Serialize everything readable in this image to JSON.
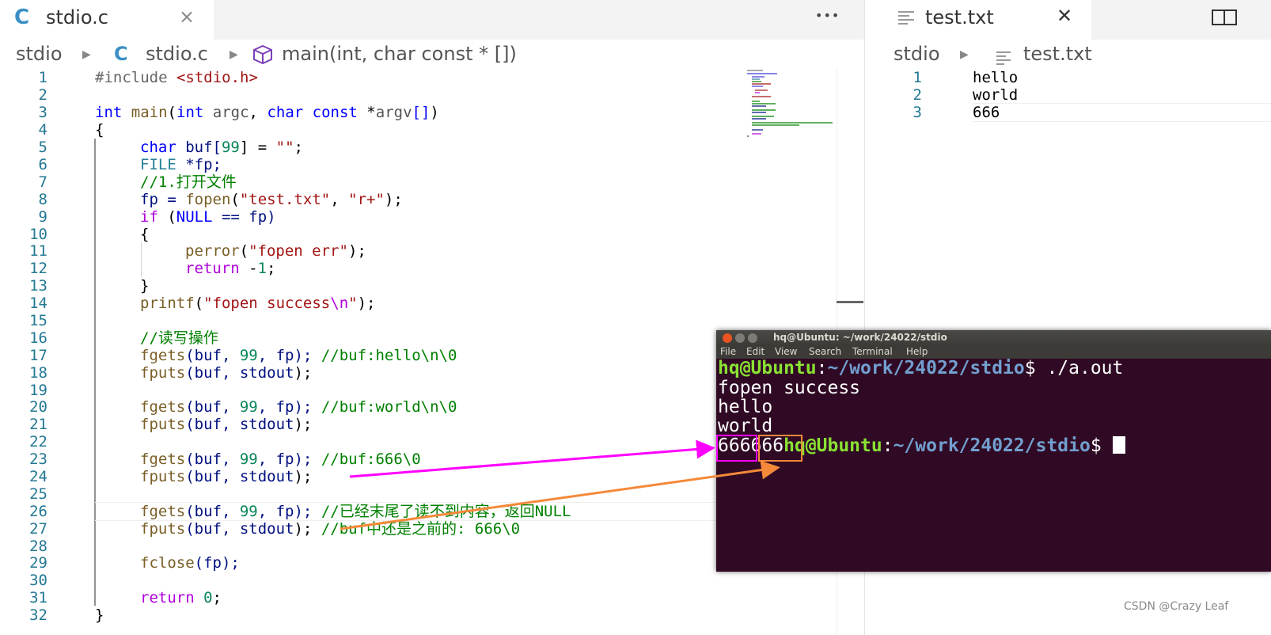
{
  "left": {
    "tab_label": "stdio.c",
    "tab_icon": "C",
    "close_glyph": "×",
    "more_glyph": "•••",
    "breadcrumb": {
      "folder": "stdio",
      "file_icon": "C",
      "file": "stdio.c",
      "symbol": "main(int, char const * [])"
    },
    "line_numbers": [
      "1",
      "2",
      "3",
      "4",
      "5",
      "6",
      "7",
      "8",
      "9",
      "10",
      "11",
      "12",
      "13",
      "14",
      "15",
      "16",
      "17",
      "18",
      "19",
      "20",
      "21",
      "22",
      "23",
      "24",
      "25",
      "26",
      "27",
      "28",
      "29",
      "30",
      "31",
      "32"
    ],
    "code": {
      "l1": {
        "a": "#include ",
        "b": "<stdio.h>"
      },
      "l3": {
        "a": "int",
        "b": " ",
        "c": "main",
        "d": "(",
        "e": "int",
        "f": " ",
        "g": "argc",
        ",": ", ",
        "h": "char",
        "i": " ",
        "j": "const",
        "k": " *",
        "l": "argv",
        "m": "[]",
        "n": ")"
      },
      "l4": "{",
      "l5": {
        "a": "char",
        "b": " buf[",
        "c": "99",
        "d": "] = ",
        "e": "\"\"",
        "f": ";"
      },
      "l6": {
        "a": "FILE",
        "b": " *fp;"
      },
      "l7": "//1.打开文件",
      "l8": {
        "a": "fp = ",
        "b": "fopen",
        "c": "(",
        "d": "\"test.txt\"",
        "e": ", ",
        "f": "\"r+\"",
        "g": ");"
      },
      "l9": {
        "a": "if",
        "b": " (",
        "c": "NULL",
        "d": " == fp)"
      },
      "l10": "{",
      "l11": {
        "a": "perror",
        "b": "(",
        "c": "\"fopen err\"",
        "d": ");"
      },
      "l12": {
        "a": "return",
        "b": " -",
        "c": "1",
        "d": ";"
      },
      "l13": "}",
      "l14": {
        "a": "printf",
        "b": "(",
        "c": "\"fopen success",
        "d": "\\n",
        "e": "\"",
        "f": ");"
      },
      "l16": "//读写操作",
      "l17": {
        "a": "fgets",
        "b": "(buf, ",
        "c": "99",
        "d": ", fp); ",
        "e": "//buf:hello\\n\\0"
      },
      "l18": {
        "a": "fputs",
        "b": "(buf, ",
        "c": "stdout",
        "d": ");"
      },
      "l20": {
        "a": "fgets",
        "b": "(buf, ",
        "c": "99",
        "d": ", fp); ",
        "e": "//buf:world\\n\\0"
      },
      "l21": {
        "a": "fputs",
        "b": "(buf, ",
        "c": "stdout",
        "d": ");"
      },
      "l23": {
        "a": "fgets",
        "b": "(buf, ",
        "c": "99",
        "d": ", fp); ",
        "e": "//buf:666\\0"
      },
      "l24": {
        "a": "fputs",
        "b": "(buf, ",
        "c": "stdout",
        "d": ");"
      },
      "l26": {
        "a": "fgets",
        "b": "(buf, ",
        "c": "99",
        "d": ", fp); ",
        "e": "//已经末尾了读不到内容，返回NULL"
      },
      "l27": {
        "a": "fputs",
        "b": "(buf, ",
        "c": "stdout",
        "d": "); ",
        "e": "//buf中还是之前的: 666\\0"
      },
      "l29": {
        "a": "fclose",
        "b": "(fp);"
      },
      "l31": {
        "a": "return",
        "b": " ",
        "c": "0",
        "d": ";"
      },
      "l32": "}"
    }
  },
  "right": {
    "tab_label": "test.txt",
    "close_glyph": "✕",
    "breadcrumb": {
      "folder": "stdio",
      "file": "test.txt"
    },
    "line_numbers": [
      "1",
      "2",
      "3"
    ],
    "lines": [
      "hello",
      "world",
      "666"
    ]
  },
  "terminal": {
    "title": "hq@Ubuntu: ~/work/24022/stdio",
    "menu": [
      "File",
      "Edit",
      "View",
      "Search",
      "Terminal",
      "Help"
    ],
    "prompt_user": "hq@Ubuntu",
    "prompt_sep": ":",
    "prompt_path": "~/work/24022/stdio",
    "prompt_end": "$ ",
    "command": "./a.out",
    "output": [
      "fopen success",
      "hello",
      "world"
    ],
    "out_a": "666",
    "out_b": "666",
    "prompt2_end": "$ "
  },
  "annotations": {
    "arrow1_color": "#ff00ff",
    "arrow2_color": "#f5893a"
  },
  "watermark": "CSDN @Crazy Leaf"
}
